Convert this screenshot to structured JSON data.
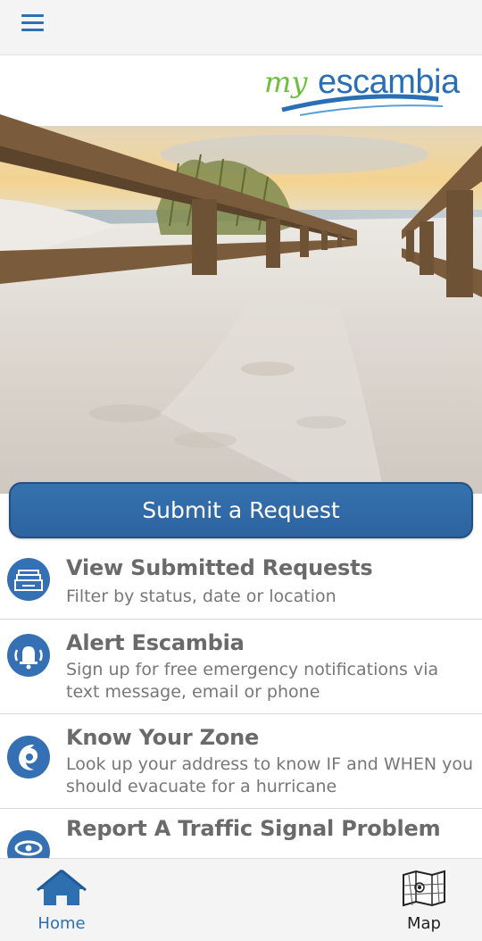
{
  "header": {
    "menu_icon": "hamburger-menu-icon"
  },
  "hero": {
    "logo_my": "my",
    "logo_name": "escambia",
    "logo_colors": {
      "my": "#6cbf3a",
      "name": "#2a6fb3"
    }
  },
  "submit_button": {
    "label": "Submit a Request"
  },
  "list": [
    {
      "icon": "inbox-tray-icon",
      "title": "View Submitted Requests",
      "desc": "Filter by status, date or location"
    },
    {
      "icon": "alarm-bell-icon",
      "title": "Alert Escambia",
      "desc": "Sign up for free emergency notifications via text message, email or phone"
    },
    {
      "icon": "hurricane-icon",
      "title": "Know Your Zone",
      "desc": "Look up your address to know IF and WHEN you should evacuate for a hurricane"
    },
    {
      "icon": "traffic-signal-icon",
      "title": "Report A Traffic Signal Problem",
      "desc": ""
    }
  ],
  "nav": {
    "home_label": "Home",
    "map_label": "Map",
    "active_color": "#2e6fb0"
  }
}
